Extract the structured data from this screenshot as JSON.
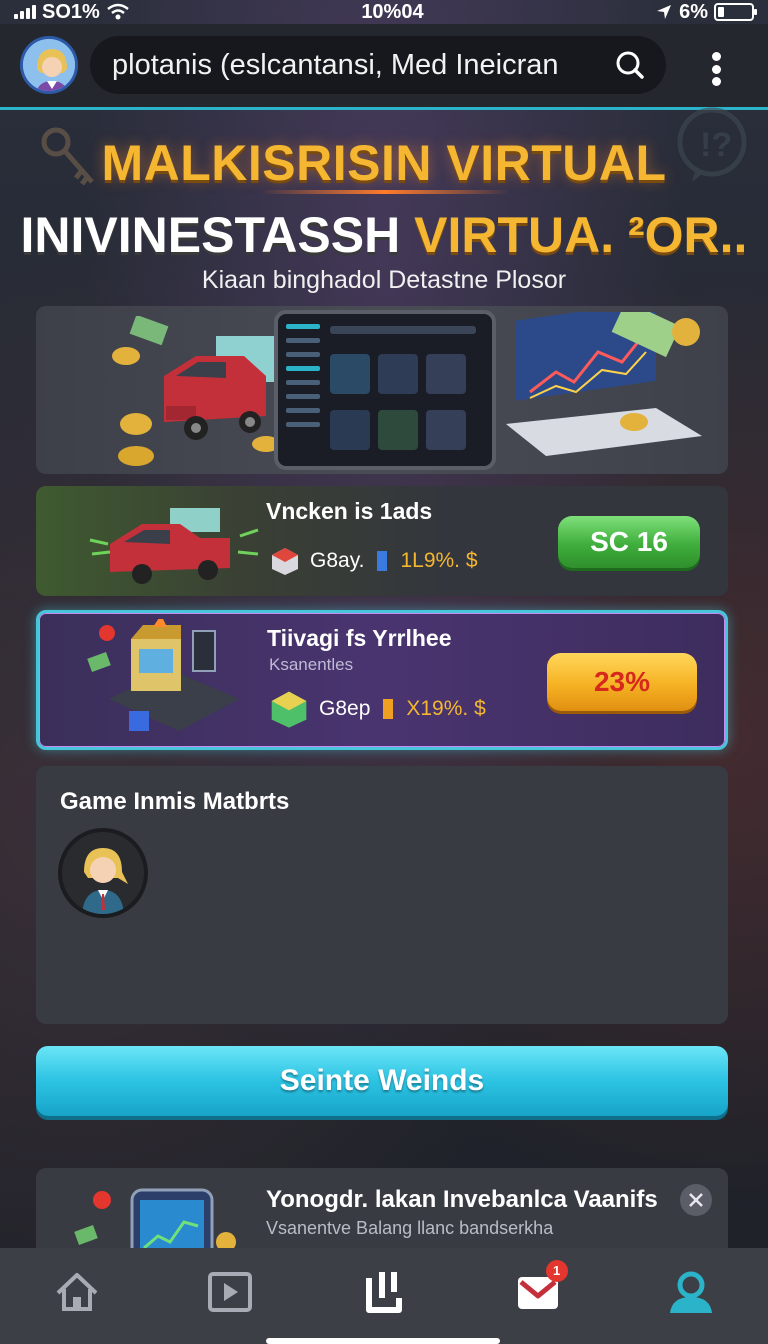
{
  "status_bar": {
    "carrier": "SO1%",
    "time": "10%04",
    "battery": "6%"
  },
  "header": {
    "search_query": "plotanis (eslcantansi, Med Ineicran",
    "avatar": "user-avatar",
    "menu_icon": "kebab-menu-icon"
  },
  "hero": {
    "title_line1": "MALKISRISIN VIRTUAL",
    "title_line2_white": "INIVINESTASSH ",
    "title_line2_gold": "VIRTUA. ²OR..",
    "subtitle": "Kiaan binghadol Detastne Plosor"
  },
  "cards": [
    {
      "title": "Vncken is 1ads",
      "meta_label": "G8ay.",
      "meta_value": "1L9%. $",
      "action_label": "SC 16"
    },
    {
      "title": "Tiivagi fs Yrrlhee",
      "subtitle": "Ksanentles",
      "meta_label": "G8ep",
      "meta_value": "X19%. $",
      "action_label": "23%"
    }
  ],
  "leaderboard": {
    "title": "Game Inmis Matbrts"
  },
  "cta": {
    "label": "Seinte Weinds"
  },
  "notification": {
    "title": "Yonogdr. lakan Invebanlca Vaanifs",
    "subtitle": "Vsanentve Balang llanc bandserkha"
  },
  "bottom_nav": {
    "items": [
      "home-icon",
      "play-icon",
      "portfolio-icon",
      "inbox-icon",
      "profile-icon"
    ],
    "inbox_badge": "1"
  },
  "colors": {
    "accent": "#2bb3c9",
    "gold": "#f5b632",
    "green": "#3fae3c",
    "yellow": "#f6b224",
    "badge": "#e2362e"
  }
}
